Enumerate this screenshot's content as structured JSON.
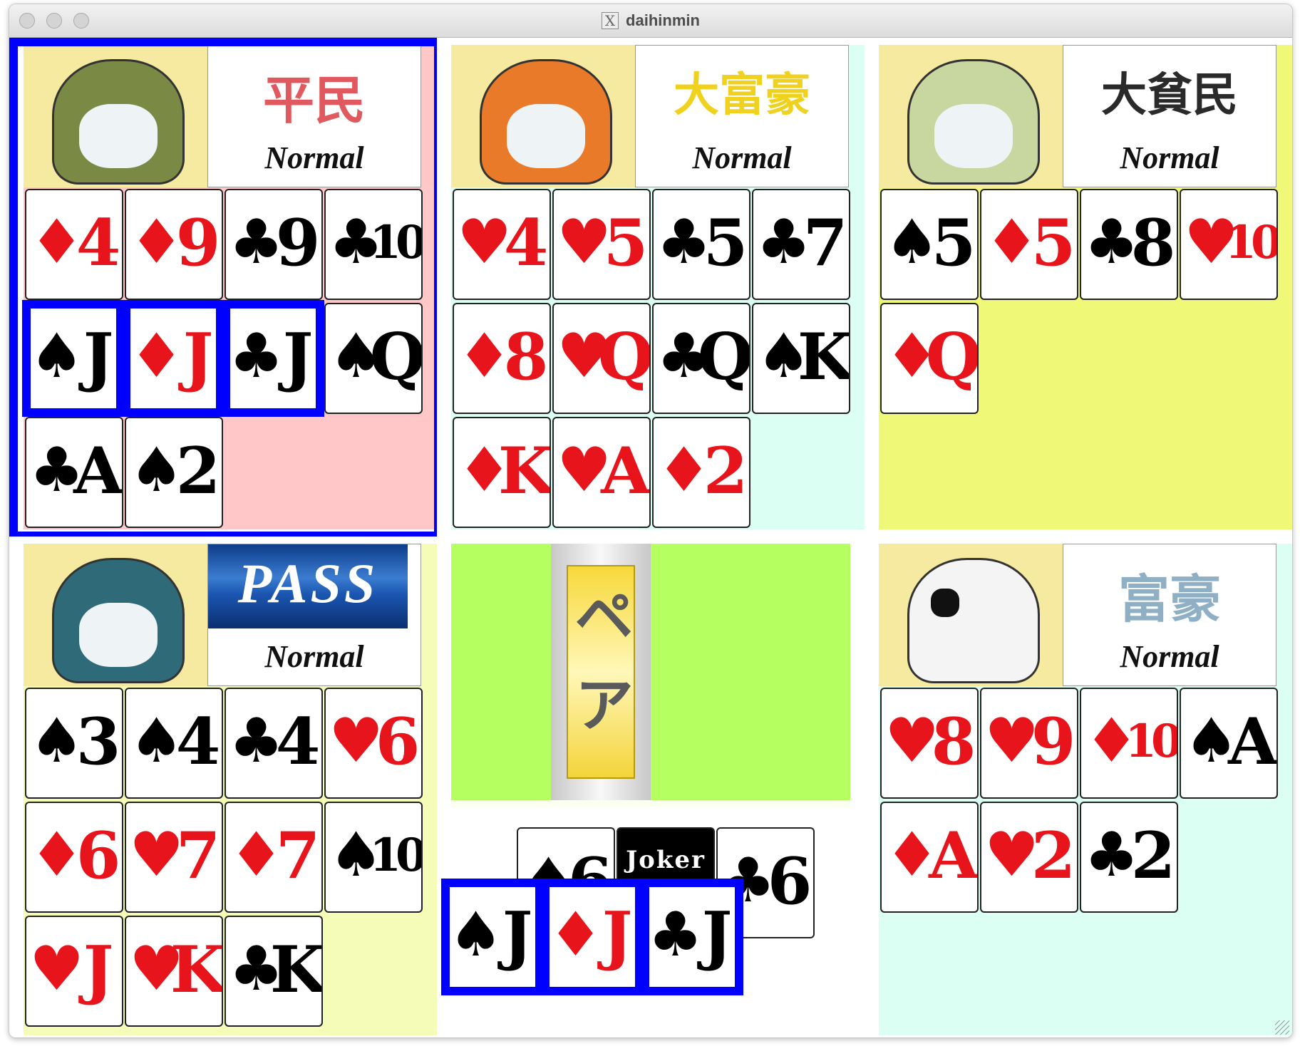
{
  "window": {
    "title": "daihinmin",
    "x_icon_label": "X"
  },
  "colors": {
    "selection": "#0000ff",
    "red_suit": "#e8141b",
    "black_suit": "#000000"
  },
  "players": [
    {
      "id": "p1",
      "avatar": "robot-mole-avatar",
      "rank": "平民",
      "rank_color": "#e0595e",
      "mode": "Normal",
      "panel_color": "#ffc7c7",
      "selected": true,
      "cards": [
        {
          "s": "♦",
          "r": "4",
          "c": "red"
        },
        {
          "s": "♦",
          "r": "9",
          "c": "red"
        },
        {
          "s": "♣",
          "r": "9",
          "c": "black"
        },
        {
          "s": "♣",
          "r": "10",
          "c": "black"
        },
        {
          "s": "♠",
          "r": "J",
          "c": "black",
          "sel": true
        },
        {
          "s": "♦",
          "r": "J",
          "c": "red",
          "sel": true
        },
        {
          "s": "♣",
          "r": "J",
          "c": "black",
          "sel": true
        },
        {
          "s": "♠",
          "r": "Q",
          "c": "black"
        },
        {
          "s": "♣",
          "r": "A",
          "c": "black"
        },
        {
          "s": "♠",
          "r": "2",
          "c": "black"
        }
      ]
    },
    {
      "id": "p2",
      "avatar": "orange-dinosaur-avatar",
      "rank": "大富豪",
      "rank_color": "#f0d21e",
      "mode": "Normal",
      "panel_color": "#dcfff4",
      "cards": [
        {
          "s": "♥",
          "r": "4",
          "c": "red"
        },
        {
          "s": "♥",
          "r": "5",
          "c": "red"
        },
        {
          "s": "♣",
          "r": "5",
          "c": "black"
        },
        {
          "s": "♣",
          "r": "7",
          "c": "black"
        },
        {
          "s": "♦",
          "r": "8",
          "c": "red"
        },
        {
          "s": "♥",
          "r": "Q",
          "c": "red"
        },
        {
          "s": "♣",
          "r": "Q",
          "c": "black"
        },
        {
          "s": "♠",
          "r": "K",
          "c": "black"
        },
        {
          "s": "♦",
          "r": "K",
          "c": "red"
        },
        {
          "s": "♥",
          "r": "A",
          "c": "red"
        },
        {
          "s": "♦",
          "r": "2",
          "c": "red"
        }
      ]
    },
    {
      "id": "p3",
      "avatar": "fish-avatar",
      "rank": "大貧民",
      "rank_color": "#2a2a2a",
      "mode": "Normal",
      "panel_color": "#f0f878",
      "cards": [
        {
          "s": "♠",
          "r": "5",
          "c": "black"
        },
        {
          "s": "♦",
          "r": "5",
          "c": "red"
        },
        {
          "s": "♣",
          "r": "8",
          "c": "black"
        },
        {
          "s": "♥",
          "r": "10",
          "c": "red"
        },
        {
          "s": "♦",
          "r": "Q",
          "c": "red"
        }
      ]
    },
    {
      "id": "p4",
      "avatar": "penguin-avatar",
      "rank": "PASS",
      "mode": "Normal",
      "panel_color": "#f4fcb8",
      "passed": true,
      "cards": [
        {
          "s": "♠",
          "r": "3",
          "c": "black"
        },
        {
          "s": "♠",
          "r": "4",
          "c": "black"
        },
        {
          "s": "♣",
          "r": "4",
          "c": "black"
        },
        {
          "s": "♥",
          "r": "6",
          "c": "red"
        },
        {
          "s": "♦",
          "r": "6",
          "c": "red"
        },
        {
          "s": "♥",
          "r": "7",
          "c": "red"
        },
        {
          "s": "♦",
          "r": "7",
          "c": "red"
        },
        {
          "s": "♠",
          "r": "10",
          "c": "black"
        },
        {
          "s": "♥",
          "r": "J",
          "c": "red"
        },
        {
          "s": "♥",
          "r": "K",
          "c": "red"
        },
        {
          "s": "♣",
          "r": "K",
          "c": "black"
        }
      ]
    },
    {
      "id": "p5",
      "avatar": "panda-avatar",
      "rank": "富豪",
      "rank_color": "#8fb0c4",
      "mode": "Normal",
      "panel_color": "#dcfff4",
      "cards": [
        {
          "s": "♥",
          "r": "8",
          "c": "red"
        },
        {
          "s": "♥",
          "r": "9",
          "c": "red"
        },
        {
          "s": "♦",
          "r": "10",
          "c": "red"
        },
        {
          "s": "♠",
          "r": "A",
          "c": "black"
        },
        {
          "s": "♦",
          "r": "A",
          "c": "red"
        },
        {
          "s": "♥",
          "r": "2",
          "c": "red"
        },
        {
          "s": "♣",
          "r": "2",
          "c": "black"
        }
      ]
    }
  ],
  "table": {
    "mode_label": "ペア",
    "previous_play": [
      {
        "s": "♠",
        "r": "6",
        "c": "black"
      },
      {
        "joker": true,
        "label": "Joker"
      },
      {
        "s": "♣",
        "r": "6",
        "c": "black"
      }
    ],
    "current_play": [
      {
        "s": "♠",
        "r": "J",
        "c": "black"
      },
      {
        "s": "♦",
        "r": "J",
        "c": "red"
      },
      {
        "s": "♣",
        "r": "J",
        "c": "black"
      }
    ]
  }
}
